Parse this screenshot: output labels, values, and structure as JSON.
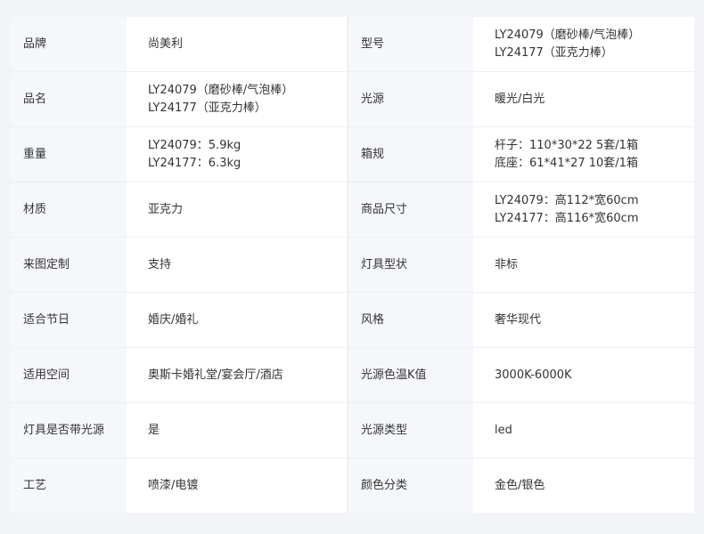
{
  "rows": [
    {
      "left": {
        "label": "品牌",
        "value": [
          "尚美利"
        ]
      },
      "right": {
        "label": "型号",
        "value": [
          "LY24079（磨砂棒/气泡棒）",
          "LY24177（亚克力棒）"
        ]
      }
    },
    {
      "left": {
        "label": "品名",
        "value": [
          "LY24079（磨砂棒/气泡棒）",
          "LY24177（亚克力棒）"
        ]
      },
      "right": {
        "label": "光源",
        "value": [
          "暖光/白光"
        ]
      }
    },
    {
      "left": {
        "label": "重量",
        "value": [
          "LY24079：5.9kg",
          "LY24177：6.3kg"
        ]
      },
      "right": {
        "label": "箱规",
        "value": [
          "杆子：110*30*22   5套/1箱",
          "底座：61*41*27   10套/1箱"
        ]
      }
    },
    {
      "left": {
        "label": "材质",
        "value": [
          "亚克力"
        ]
      },
      "right": {
        "label": "商品尺寸",
        "value": [
          "LY24079：高112*宽60cm",
          "LY24177：高116*宽60cm"
        ]
      }
    },
    {
      "left": {
        "label": "来图定制",
        "value": [
          "支持"
        ]
      },
      "right": {
        "label": "灯具型状",
        "value": [
          "非标"
        ]
      }
    },
    {
      "left": {
        "label": "适合节日",
        "value": [
          "婚庆/婚礼"
        ]
      },
      "right": {
        "label": "风格",
        "value": [
          "奢华现代"
        ]
      }
    },
    {
      "left": {
        "label": "适用空间",
        "value": [
          "奥斯卡婚礼堂/宴会厅/酒店"
        ]
      },
      "right": {
        "label": "光源色温K值",
        "value": [
          "3000K-6000K"
        ]
      }
    },
    {
      "left": {
        "label": "灯具是否带光源",
        "value": [
          "是"
        ]
      },
      "right": {
        "label": "光源类型",
        "value": [
          "led"
        ]
      }
    },
    {
      "left": {
        "label": "工艺",
        "value": [
          "喷漆/电镀"
        ]
      },
      "right": {
        "label": "颜色分类",
        "value": [
          "金色/银色"
        ]
      }
    }
  ]
}
